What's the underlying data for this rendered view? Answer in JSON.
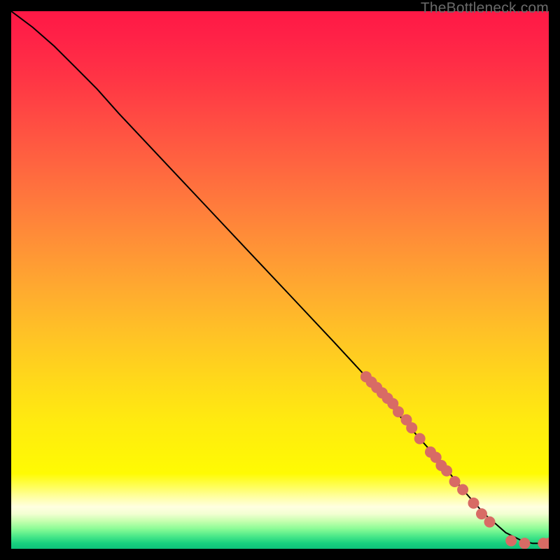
{
  "watermark": "TheBottleneck.com",
  "chart_data": {
    "type": "line",
    "title": "",
    "xlabel": "",
    "ylabel": "",
    "xlim": [
      0,
      100
    ],
    "ylim": [
      0,
      100
    ],
    "grid": false,
    "legend": false,
    "annotations": [],
    "series": [
      {
        "name": "curve",
        "style": "line",
        "color": "#000000",
        "x": [
          0,
          4,
          8,
          12,
          16,
          20,
          28,
          36,
          44,
          52,
          60,
          66,
          72,
          76,
          80,
          84,
          88,
          92,
          95,
          97,
          100
        ],
        "y": [
          100,
          97,
          93.5,
          89.5,
          85.5,
          81,
          72.5,
          64,
          55.5,
          47,
          38.5,
          32,
          25,
          20.5,
          16,
          11,
          6.5,
          3,
          1.5,
          1,
          1
        ]
      },
      {
        "name": "dots",
        "style": "scatter",
        "color": "#d86b65",
        "x": [
          66,
          67,
          68,
          69,
          70,
          71,
          72,
          73.5,
          74.5,
          76,
          78,
          79,
          80,
          81,
          82.5,
          84,
          86,
          87.5,
          89,
          93,
          95.5,
          99,
          100
        ],
        "y": [
          32,
          31,
          30,
          29,
          28,
          27,
          25.5,
          24,
          22.5,
          20.5,
          18,
          17,
          15.5,
          14.5,
          12.5,
          11,
          8.5,
          6.5,
          5,
          1.5,
          1,
          1,
          1
        ]
      }
    ],
    "background_gradient_stops": [
      {
        "offset": 0.0,
        "color": "#ff1846"
      },
      {
        "offset": 0.05,
        "color": "#ff2247"
      },
      {
        "offset": 0.12,
        "color": "#ff3345"
      },
      {
        "offset": 0.2,
        "color": "#ff4b43"
      },
      {
        "offset": 0.28,
        "color": "#ff6340"
      },
      {
        "offset": 0.36,
        "color": "#ff7b3c"
      },
      {
        "offset": 0.44,
        "color": "#ff9336"
      },
      {
        "offset": 0.52,
        "color": "#ffab2f"
      },
      {
        "offset": 0.6,
        "color": "#ffc226"
      },
      {
        "offset": 0.68,
        "color": "#ffd71b"
      },
      {
        "offset": 0.76,
        "color": "#ffea10"
      },
      {
        "offset": 0.82,
        "color": "#fff408"
      },
      {
        "offset": 0.86,
        "color": "#fffb03"
      },
      {
        "offset": 0.885,
        "color": "#fffe5c"
      },
      {
        "offset": 0.905,
        "color": "#ffffa8"
      },
      {
        "offset": 0.922,
        "color": "#ffffe0"
      },
      {
        "offset": 0.935,
        "color": "#f3ffd2"
      },
      {
        "offset": 0.948,
        "color": "#c8ffb0"
      },
      {
        "offset": 0.962,
        "color": "#8efc97"
      },
      {
        "offset": 0.976,
        "color": "#4de98a"
      },
      {
        "offset": 0.99,
        "color": "#17d07e"
      },
      {
        "offset": 1.0,
        "color": "#0fc27a"
      }
    ]
  }
}
